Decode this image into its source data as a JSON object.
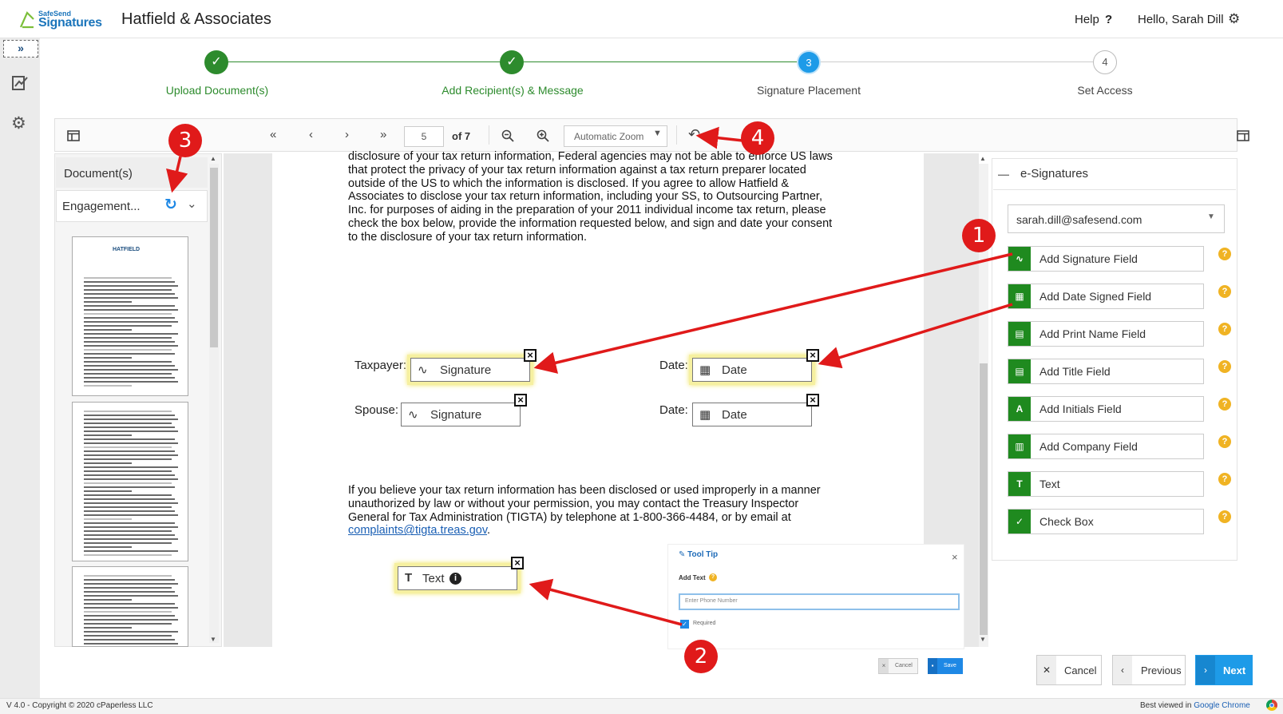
{
  "header": {
    "logo_small": "SafeSend",
    "logo_big": "Signatures",
    "firm_name": "Hatfield & Associates",
    "help_label": "Help",
    "greeting": "Hello, Sarah Dill"
  },
  "rail": {
    "expand_glyph": "»"
  },
  "stepper": {
    "steps": [
      {
        "number": "✓",
        "label": "Upload Document(s)",
        "state": "done"
      },
      {
        "number": "✓",
        "label": "Add Recipient(s) & Message",
        "state": "done"
      },
      {
        "number": "3",
        "label": "Signature Placement",
        "state": "active"
      },
      {
        "number": "4",
        "label": "Set Access",
        "state": "todo"
      }
    ],
    "colors": {
      "done": "#2d8b2d",
      "active": "#1e9be8",
      "todo": "#bbbbbb"
    }
  },
  "toolbar": {
    "page_number": "5",
    "page_total": "of 7",
    "zoom": "Automatic Zoom"
  },
  "documents": {
    "header": "Document(s)",
    "current": "Engagement...",
    "thumb_title": "HATFIELD"
  },
  "page": {
    "para1": [
      "disclosure of your tax return information, Federal agencies may not be able to enforce US laws",
      "that protect the privacy of your tax return information against a tax return preparer located",
      "outside of the US to which the information is disclosed. If you agree to allow Hatfield &",
      "Associates to disclose your tax return information, including your SS, to Outsourcing Partner,",
      "Inc. for purposes of aiding in the preparation of your 2011 individual income tax return, please",
      "check the box below, provide the information requested below, and sign and date your consent",
      "to the disclosure of your tax return information."
    ],
    "taxpayer_label": "Taxpayer:",
    "spouse_label": "Spouse:",
    "date_label": "Date:",
    "signature_field": "Signature",
    "date_field": "Date",
    "para2": [
      "If you believe your tax return information has been disclosed or used improperly in a manner",
      "unauthorized by law or without your permission, you may contact the Treasury Inspector",
      "General for Tax Administration (TIGTA) by telephone at 1-800-366-4484, or by email at"
    ],
    "email_link": "complaints@tigta.treas.gov",
    "email_suffix": ".",
    "text_field": "Text"
  },
  "esignatures": {
    "title": "e-Signatures",
    "recipient": "sarah.dill@safesend.com",
    "tools": [
      {
        "label": "Add Signature Field",
        "icon": "signature-icon",
        "glyph": "∿"
      },
      {
        "label": "Add Date Signed Field",
        "icon": "calendar-icon",
        "glyph": "▦"
      },
      {
        "label": "Add Print Name Field",
        "icon": "name-card-icon",
        "glyph": "▤"
      },
      {
        "label": "Add Title Field",
        "icon": "title-card-icon",
        "glyph": "▤"
      },
      {
        "label": "Add Initials Field",
        "icon": "initials-icon",
        "glyph": "A"
      },
      {
        "label": "Add Company Field",
        "icon": "company-icon",
        "glyph": "▥"
      },
      {
        "label": "Text",
        "icon": "text-field-icon",
        "glyph": "T"
      },
      {
        "label": "Check Box",
        "icon": "checkbox-icon",
        "glyph": "✓"
      }
    ],
    "accent": "#1f8a1f",
    "help_color": "#f0b323"
  },
  "tooltip": {
    "title": "Tool Tip",
    "label": "Add Text",
    "input_value": "Enter Phone Number",
    "required_label": "Required",
    "cancel_label": "Cancel",
    "save_label": "Save"
  },
  "nav": {
    "cancel": "Cancel",
    "previous": "Previous",
    "next": "Next",
    "next_color": "#1e9be8"
  },
  "annotations": {
    "badges": [
      "1",
      "2",
      "3",
      "4"
    ],
    "color": "#e01a1a"
  },
  "footer": {
    "version": "V 4.0 - Copyright © 2020 cPaperless LLC",
    "best_viewed": "Best viewed in",
    "browser": "Google Chrome"
  }
}
